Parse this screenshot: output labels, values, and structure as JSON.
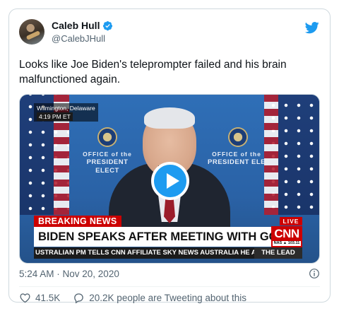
{
  "author": {
    "display_name": "Caleb Hull",
    "handle": "@CalebJHull",
    "verified": true
  },
  "tweet": {
    "text": "Looks like Joe Biden's teleprompter failed and his brain malfunctioned again.",
    "timestamp": "5:24 AM · Nov 20, 2020"
  },
  "video": {
    "dateline_location": "Wilmington, Delaware",
    "dateline_time": "4:19 PM ET",
    "backdrop_left_line1": "OFFICE of the",
    "backdrop_left_line2": "PRESIDENT ELECT",
    "backdrop_right_line1": "OFFICE of the",
    "backdrop_right_line2": "PRESIDENT ELE",
    "breaking_label": "BREAKING NEWS",
    "live_label": "LIVE",
    "headline": "BIDEN SPEAKS AFTER MEETING WITH GOVERNORS",
    "network": "CNN",
    "network_sub": "NAS ▲ 103.11",
    "ticker": "USTRALIAN PM TELLS CNN AFFILIATE SKY NEWS AUSTRALIA HE ASSURES A",
    "show_name": "THE LEAD"
  },
  "engagement": {
    "likes": "41.5K",
    "conversation": "20.2K people are Tweeting about this"
  },
  "colors": {
    "accent": "#1d9bf0",
    "cnn_red": "#cc0000",
    "muted_text": "#536471"
  },
  "icons": {
    "verified": "verified-badge-icon",
    "brand": "twitter-bird-icon",
    "play": "play-icon",
    "info": "info-icon",
    "like": "heart-icon",
    "reply": "speech-bubble-icon"
  }
}
